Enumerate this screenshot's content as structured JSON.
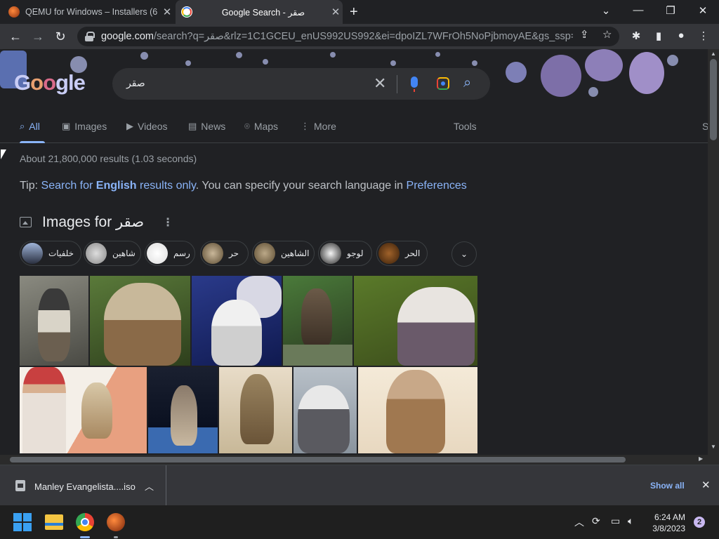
{
  "browser": {
    "tabs": [
      {
        "title": "QEMU for Windows – Installers (6",
        "favicon": "qemu-icon"
      },
      {
        "title": "Google Search - صقر",
        "favicon": "google-icon"
      }
    ],
    "new_tab": "+",
    "url_domain": "google.com",
    "url_rest": "/search?q=صقر&rlz=1C1GCEU_enUS992US992&ei=dpoIZL7WFrOh5NoPjbmoyAE&gs_ssp=eJzj..."
  },
  "google": {
    "logo": "Google",
    "query": "صقر",
    "nav": {
      "all": "All",
      "images": "Images",
      "videos": "Videos",
      "news": "News",
      "maps": "Maps",
      "more": "More",
      "tools": "Tools",
      "s": "S"
    },
    "stats": "About 21,800,000 results (1.03 seconds)",
    "tip": {
      "prefix": "Tip: ",
      "link1": "Search for ",
      "bold": "English",
      "link2": " results only",
      "middle": ". You can specify your search language in ",
      "preferences": "Preferences"
    },
    "images_heading": "Images for صقر",
    "chips": [
      "خلفيات",
      "شاهين",
      "رسم",
      "حر",
      "الشاهين",
      "لوجو",
      "الحر"
    ]
  },
  "downloads": {
    "file": "Manley Evangelista....iso",
    "show_all": "Show all"
  },
  "taskbar": {
    "time": "6:24 AM",
    "date": "3/8/2023",
    "notifications": "2"
  },
  "colors": {
    "accent": "#8ab4f8",
    "background": "#202124",
    "toolbar": "#35363a"
  }
}
